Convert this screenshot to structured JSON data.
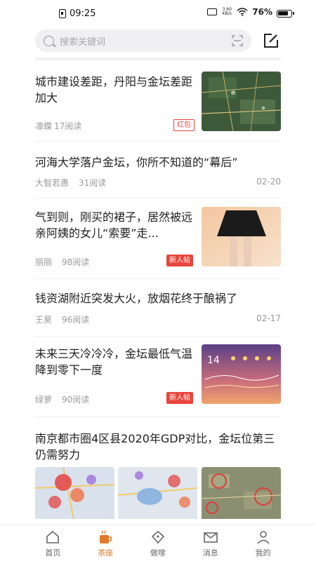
{
  "status": {
    "time": "09:25",
    "net_speed": "3.60\nKB/s",
    "network": "5G",
    "battery": "76%"
  },
  "search": {
    "placeholder": "搜索关键词"
  },
  "feed": [
    {
      "title": "城市建设差距，丹阳与金坛差距加大",
      "author": "凛蝶",
      "reads": "17阅读",
      "tag": "红包",
      "thumb": "map-satellite"
    },
    {
      "title": "河海大学落户金坛，你所不知道的“幕后”",
      "author": "大智若愚",
      "reads": "31阅读",
      "date": "02-20"
    },
    {
      "title": "气到则，刚买的裙子，居然被远亲阿姨的女儿“索要”走...",
      "author": "丽丽",
      "reads": "98阅读",
      "tag": "新人帖",
      "thumb": "skirt-photo"
    },
    {
      "title": "钱资湖附近突发大火，放烟花终于酿祸了",
      "author": "王昊",
      "reads": "96阅读",
      "date": "02-17"
    },
    {
      "title": "未来三天冷冷冷，金坛最低气温降到零下一度",
      "author": "绿萝",
      "reads": "90阅读",
      "tag": "新人帖",
      "thumb": "weather-card",
      "weather_temp": "14"
    },
    {
      "title": "南京都市圈4区县2020年GDP对比，金坛位第三仍需努力",
      "thumbs": [
        "heat-map-1",
        "heat-map-2",
        "satellite-map"
      ]
    }
  ],
  "tabs": [
    {
      "label": "首页",
      "icon": "home-icon",
      "active": false
    },
    {
      "label": "茶座",
      "icon": "tea-cup-icon",
      "active": true
    },
    {
      "label": "做嗲",
      "icon": "diamond-icon",
      "active": false
    },
    {
      "label": "消息",
      "icon": "mail-icon",
      "active": false
    },
    {
      "label": "我的",
      "icon": "person-icon",
      "active": false
    }
  ],
  "colors": {
    "accent": "#e27a2a",
    "tag_red": "#e8453c",
    "meta_gray": "#999999"
  }
}
